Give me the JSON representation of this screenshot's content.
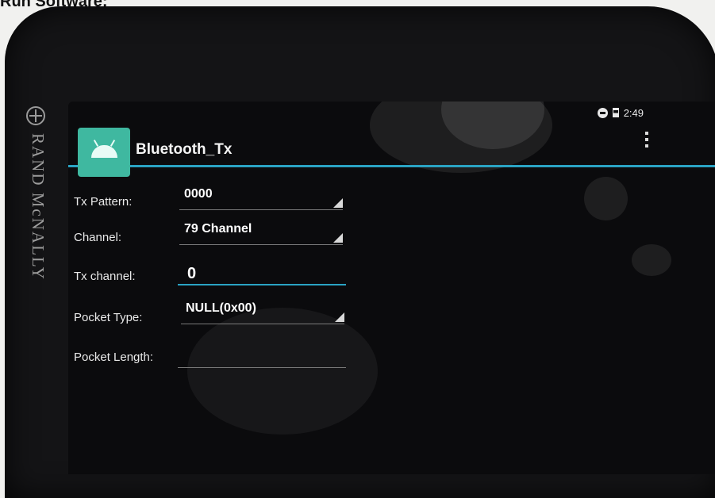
{
  "caption": "Run Software:",
  "device": {
    "brand": "RAND McNALLY"
  },
  "status_bar": {
    "time": "2:49",
    "icons": [
      "do-not-disturb-icon",
      "battery-icon"
    ]
  },
  "app": {
    "title": "Bluetooth_Tx",
    "icon": "android-app-icon",
    "accent": "#2aa3c3"
  },
  "form": {
    "tx_pattern": {
      "label": "Tx Pattern:",
      "value": "0000"
    },
    "channel": {
      "label": "Channel:",
      "value": "79 Channel"
    },
    "tx_channel": {
      "label": "Tx channel:",
      "value": "0"
    },
    "pocket_type": {
      "label": "Pocket Type:",
      "value": "NULL(0x00)"
    },
    "pocket_length": {
      "label": "Pocket Length:",
      "value": ""
    }
  }
}
